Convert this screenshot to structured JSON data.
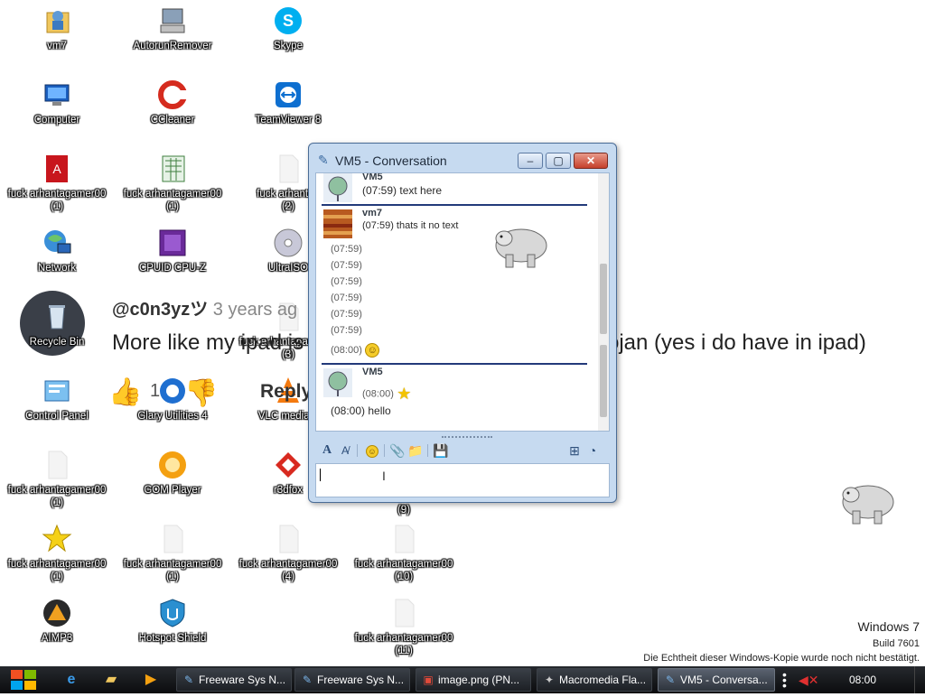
{
  "desktop": {
    "icons": [
      {
        "label": "vm7",
        "icon": "user-folder-icon"
      },
      {
        "label": "AutorunRemover",
        "icon": "computer-tool-icon"
      },
      {
        "label": "Skype",
        "icon": "skype-icon"
      },
      {
        "label": "Computer",
        "icon": "computer-icon"
      },
      {
        "label": "CCleaner",
        "icon": "ccleaner-icon"
      },
      {
        "label": "TeamViewer 8",
        "icon": "teamviewer-icon"
      },
      {
        "label": "fuck arhantagamer00\n(1)",
        "icon": "pdf-icon"
      },
      {
        "label": "fuck arhantagamer00\n(1)",
        "icon": "spreadsheet-file-icon"
      },
      {
        "label": "fuck arhantag\n(2)",
        "icon": "blank-file-icon"
      },
      {
        "label": "Network",
        "icon": "network-icon"
      },
      {
        "label": "CPUID CPU-Z",
        "icon": "cpu-z-icon"
      },
      {
        "label": "UltraISO",
        "icon": "disc-icon"
      },
      {
        "label": "Recycle Bin",
        "icon": "recycle-bin-icon"
      },
      {
        "label": "fuck arhantagamer00\n(3)",
        "icon": "blank-file-icon"
      },
      {
        "label": "Control Panel",
        "icon": "control-panel-icon"
      },
      {
        "label": "Glary Utilities 4",
        "icon": "glary-icon"
      },
      {
        "label": "VLC media p",
        "icon": "vlc-icon"
      },
      {
        "label": "fuck arhantagamer00\n(1)",
        "icon": "blank-file-icon"
      },
      {
        "label": "GOM Player",
        "icon": "gom-player-icon"
      },
      {
        "label": "r3dfox",
        "icon": "r3dfox-icon"
      },
      {
        "label": "(9)",
        "icon": "blank-file-icon"
      },
      {
        "label": "fuck arhantagamer00\n(1)",
        "icon": "star-icon"
      },
      {
        "label": "fuck arhantagamer00\n(1)",
        "icon": "blank-file-icon"
      },
      {
        "label": "fuck arhantagamer00\n(4)",
        "icon": "blank-file-icon"
      },
      {
        "label": "fuck arhantagamer00\n(10)",
        "icon": "blank-file-icon"
      },
      {
        "label": "AIMP3",
        "icon": "aimp-icon"
      },
      {
        "label": "Hotspot Shield",
        "icon": "shield-icon"
      },
      {
        "label": "fuck arhantagamer00\n(11)",
        "icon": "blank-file-icon"
      }
    ]
  },
  "overlay": {
    "user": "@c0n3yzツ",
    "time": "3 years ag",
    "comment_start": "More like my ipad is",
    "comment_end": "ojan (yes i do have in ipad)",
    "like_count": "1",
    "reply": "Reply"
  },
  "window": {
    "title": "VM5 - Conversation",
    "minimize": "–",
    "maximize": "▢",
    "close": "✕",
    "messages": {
      "m1_sender": "VM5",
      "m1_line": "(07:59) text here",
      "m2_sender": "vm7",
      "m2_line": "(07:59) thats it no text",
      "empty_ts": [
        "(07:59)",
        "(07:59)",
        "(07:59)",
        "(07:59)",
        "(07:59)",
        "(07:59)"
      ],
      "m2_smile_ts": "(08:00)",
      "m3_sender": "VM5",
      "m3_star_ts": "(08:00)",
      "m3_line": "(08:00) hello"
    },
    "input_value": ""
  },
  "watermark": {
    "line1": "Windows 7",
    "line2": "Build 7601",
    "line3": "Die Echtheit dieser Windows-Kopie wurde noch nicht bestätigt."
  },
  "taskbar": {
    "tasks": [
      {
        "label": "Freeware Sys N...",
        "icon": "app-icon"
      },
      {
        "label": "Freeware Sys N...",
        "icon": "app-icon"
      },
      {
        "label": "image.png (PN...",
        "icon": "image-icon"
      },
      {
        "label": "Macromedia Fla...",
        "icon": "flash-icon"
      },
      {
        "label": "VM5 - Conversa...",
        "icon": "chat-icon"
      }
    ],
    "clock": "08:00"
  },
  "colors": {
    "accent": "#233a7a",
    "window_frame": "#c6daf0",
    "taskbar": "#1a1c20"
  }
}
